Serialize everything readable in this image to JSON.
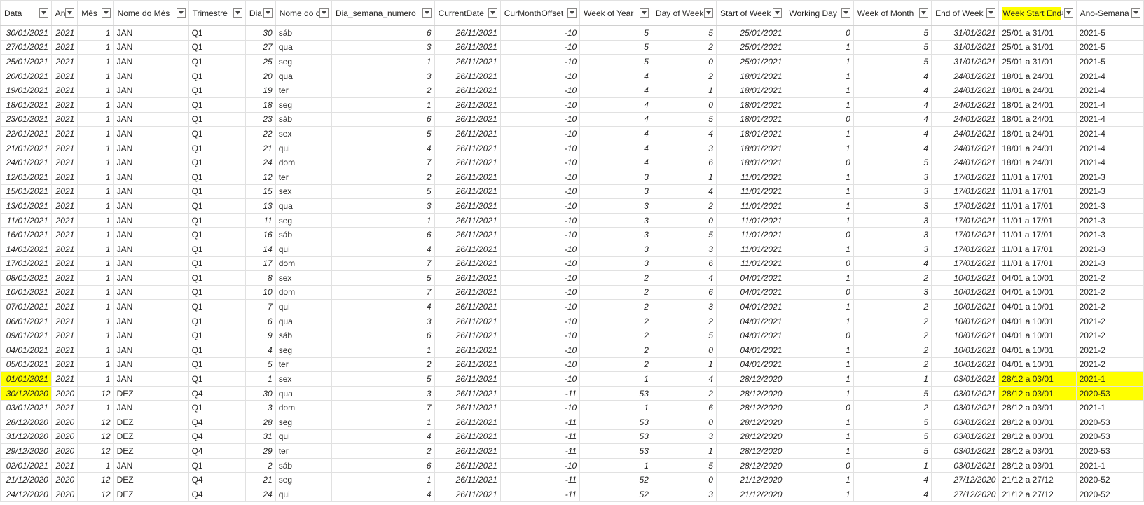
{
  "columns": [
    {
      "label": "Data",
      "type": "d"
    },
    {
      "label": "Ano",
      "type": "n"
    },
    {
      "label": "Mês",
      "type": "n"
    },
    {
      "label": "Nome do Mês",
      "type": "t"
    },
    {
      "label": "Trimestre",
      "type": "t"
    },
    {
      "label": "Dia",
      "type": "n"
    },
    {
      "label": "Nome do dia",
      "type": "t"
    },
    {
      "label": "Dia_semana_numero",
      "type": "n"
    },
    {
      "label": "CurrentDate",
      "type": "d"
    },
    {
      "label": "CurMonthOffset",
      "type": "n"
    },
    {
      "label": "Week of Year",
      "type": "n"
    },
    {
      "label": "Day of Week",
      "type": "n"
    },
    {
      "label": "Start of Week",
      "type": "d"
    },
    {
      "label": "Working Day",
      "type": "n"
    },
    {
      "label": "Week of Month",
      "type": "n"
    },
    {
      "label": "End of Week",
      "type": "d"
    },
    {
      "label": "Week Start End",
      "type": "t",
      "highlight": true,
      "sort": "desc"
    },
    {
      "label": "Ano-Semana",
      "type": "t"
    }
  ],
  "highlight_color": "#ffff00",
  "rows": [
    {
      "cells": [
        "30/01/2021",
        "2021",
        "1",
        "JAN",
        "Q1",
        "30",
        "sáb",
        "6",
        "26/11/2021",
        "-10",
        "5",
        "5",
        "25/01/2021",
        "0",
        "5",
        "31/01/2021",
        "25/01 a 31/01",
        "2021-5"
      ]
    },
    {
      "cells": [
        "27/01/2021",
        "2021",
        "1",
        "JAN",
        "Q1",
        "27",
        "qua",
        "3",
        "26/11/2021",
        "-10",
        "5",
        "2",
        "25/01/2021",
        "1",
        "5",
        "31/01/2021",
        "25/01 a 31/01",
        "2021-5"
      ]
    },
    {
      "cells": [
        "25/01/2021",
        "2021",
        "1",
        "JAN",
        "Q1",
        "25",
        "seg",
        "1",
        "26/11/2021",
        "-10",
        "5",
        "0",
        "25/01/2021",
        "1",
        "5",
        "31/01/2021",
        "25/01 a 31/01",
        "2021-5"
      ]
    },
    {
      "cells": [
        "20/01/2021",
        "2021",
        "1",
        "JAN",
        "Q1",
        "20",
        "qua",
        "3",
        "26/11/2021",
        "-10",
        "4",
        "2",
        "18/01/2021",
        "1",
        "4",
        "24/01/2021",
        "18/01 a 24/01",
        "2021-4"
      ]
    },
    {
      "cells": [
        "19/01/2021",
        "2021",
        "1",
        "JAN",
        "Q1",
        "19",
        "ter",
        "2",
        "26/11/2021",
        "-10",
        "4",
        "1",
        "18/01/2021",
        "1",
        "4",
        "24/01/2021",
        "18/01 a 24/01",
        "2021-4"
      ]
    },
    {
      "cells": [
        "18/01/2021",
        "2021",
        "1",
        "JAN",
        "Q1",
        "18",
        "seg",
        "1",
        "26/11/2021",
        "-10",
        "4",
        "0",
        "18/01/2021",
        "1",
        "4",
        "24/01/2021",
        "18/01 a 24/01",
        "2021-4"
      ]
    },
    {
      "cells": [
        "23/01/2021",
        "2021",
        "1",
        "JAN",
        "Q1",
        "23",
        "sáb",
        "6",
        "26/11/2021",
        "-10",
        "4",
        "5",
        "18/01/2021",
        "0",
        "4",
        "24/01/2021",
        "18/01 a 24/01",
        "2021-4"
      ]
    },
    {
      "cells": [
        "22/01/2021",
        "2021",
        "1",
        "JAN",
        "Q1",
        "22",
        "sex",
        "5",
        "26/11/2021",
        "-10",
        "4",
        "4",
        "18/01/2021",
        "1",
        "4",
        "24/01/2021",
        "18/01 a 24/01",
        "2021-4"
      ]
    },
    {
      "cells": [
        "21/01/2021",
        "2021",
        "1",
        "JAN",
        "Q1",
        "21",
        "qui",
        "4",
        "26/11/2021",
        "-10",
        "4",
        "3",
        "18/01/2021",
        "1",
        "4",
        "24/01/2021",
        "18/01 a 24/01",
        "2021-4"
      ]
    },
    {
      "cells": [
        "24/01/2021",
        "2021",
        "1",
        "JAN",
        "Q1",
        "24",
        "dom",
        "7",
        "26/11/2021",
        "-10",
        "4",
        "6",
        "18/01/2021",
        "0",
        "5",
        "24/01/2021",
        "18/01 a 24/01",
        "2021-4"
      ]
    },
    {
      "cells": [
        "12/01/2021",
        "2021",
        "1",
        "JAN",
        "Q1",
        "12",
        "ter",
        "2",
        "26/11/2021",
        "-10",
        "3",
        "1",
        "11/01/2021",
        "1",
        "3",
        "17/01/2021",
        "11/01 a 17/01",
        "2021-3"
      ]
    },
    {
      "cells": [
        "15/01/2021",
        "2021",
        "1",
        "JAN",
        "Q1",
        "15",
        "sex",
        "5",
        "26/11/2021",
        "-10",
        "3",
        "4",
        "11/01/2021",
        "1",
        "3",
        "17/01/2021",
        "11/01 a 17/01",
        "2021-3"
      ]
    },
    {
      "cells": [
        "13/01/2021",
        "2021",
        "1",
        "JAN",
        "Q1",
        "13",
        "qua",
        "3",
        "26/11/2021",
        "-10",
        "3",
        "2",
        "11/01/2021",
        "1",
        "3",
        "17/01/2021",
        "11/01 a 17/01",
        "2021-3"
      ]
    },
    {
      "cells": [
        "11/01/2021",
        "2021",
        "1",
        "JAN",
        "Q1",
        "11",
        "seg",
        "1",
        "26/11/2021",
        "-10",
        "3",
        "0",
        "11/01/2021",
        "1",
        "3",
        "17/01/2021",
        "11/01 a 17/01",
        "2021-3"
      ]
    },
    {
      "cells": [
        "16/01/2021",
        "2021",
        "1",
        "JAN",
        "Q1",
        "16",
        "sáb",
        "6",
        "26/11/2021",
        "-10",
        "3",
        "5",
        "11/01/2021",
        "0",
        "3",
        "17/01/2021",
        "11/01 a 17/01",
        "2021-3"
      ]
    },
    {
      "cells": [
        "14/01/2021",
        "2021",
        "1",
        "JAN",
        "Q1",
        "14",
        "qui",
        "4",
        "26/11/2021",
        "-10",
        "3",
        "3",
        "11/01/2021",
        "1",
        "3",
        "17/01/2021",
        "11/01 a 17/01",
        "2021-3"
      ]
    },
    {
      "cells": [
        "17/01/2021",
        "2021",
        "1",
        "JAN",
        "Q1",
        "17",
        "dom",
        "7",
        "26/11/2021",
        "-10",
        "3",
        "6",
        "11/01/2021",
        "0",
        "4",
        "17/01/2021",
        "11/01 a 17/01",
        "2021-3"
      ]
    },
    {
      "cells": [
        "08/01/2021",
        "2021",
        "1",
        "JAN",
        "Q1",
        "8",
        "sex",
        "5",
        "26/11/2021",
        "-10",
        "2",
        "4",
        "04/01/2021",
        "1",
        "2",
        "10/01/2021",
        "04/01 a 10/01",
        "2021-2"
      ]
    },
    {
      "cells": [
        "10/01/2021",
        "2021",
        "1",
        "JAN",
        "Q1",
        "10",
        "dom",
        "7",
        "26/11/2021",
        "-10",
        "2",
        "6",
        "04/01/2021",
        "0",
        "3",
        "10/01/2021",
        "04/01 a 10/01",
        "2021-2"
      ]
    },
    {
      "cells": [
        "07/01/2021",
        "2021",
        "1",
        "JAN",
        "Q1",
        "7",
        "qui",
        "4",
        "26/11/2021",
        "-10",
        "2",
        "3",
        "04/01/2021",
        "1",
        "2",
        "10/01/2021",
        "04/01 a 10/01",
        "2021-2"
      ]
    },
    {
      "cells": [
        "06/01/2021",
        "2021",
        "1",
        "JAN",
        "Q1",
        "6",
        "qua",
        "3",
        "26/11/2021",
        "-10",
        "2",
        "2",
        "04/01/2021",
        "1",
        "2",
        "10/01/2021",
        "04/01 a 10/01",
        "2021-2"
      ]
    },
    {
      "cells": [
        "09/01/2021",
        "2021",
        "1",
        "JAN",
        "Q1",
        "9",
        "sáb",
        "6",
        "26/11/2021",
        "-10",
        "2",
        "5",
        "04/01/2021",
        "0",
        "2",
        "10/01/2021",
        "04/01 a 10/01",
        "2021-2"
      ]
    },
    {
      "cells": [
        "04/01/2021",
        "2021",
        "1",
        "JAN",
        "Q1",
        "4",
        "seg",
        "1",
        "26/11/2021",
        "-10",
        "2",
        "0",
        "04/01/2021",
        "1",
        "2",
        "10/01/2021",
        "04/01 a 10/01",
        "2021-2"
      ]
    },
    {
      "cells": [
        "05/01/2021",
        "2021",
        "1",
        "JAN",
        "Q1",
        "5",
        "ter",
        "2",
        "26/11/2021",
        "-10",
        "2",
        "1",
        "04/01/2021",
        "1",
        "2",
        "10/01/2021",
        "04/01 a 10/01",
        "2021-2"
      ]
    },
    {
      "cells": [
        "01/01/2021",
        "2021",
        "1",
        "JAN",
        "Q1",
        "1",
        "sex",
        "5",
        "26/11/2021",
        "-10",
        "1",
        "4",
        "28/12/2020",
        "1",
        "1",
        "03/01/2021",
        "28/12 a 03/01",
        "2021-1"
      ],
      "highlight": [
        0,
        16,
        17
      ]
    },
    {
      "cells": [
        "30/12/2020",
        "2020",
        "12",
        "DEZ",
        "Q4",
        "30",
        "qua",
        "3",
        "26/11/2021",
        "-11",
        "53",
        "2",
        "28/12/2020",
        "1",
        "5",
        "03/01/2021",
        "28/12 a 03/01",
        "2020-53"
      ],
      "highlight": [
        0,
        16,
        17
      ]
    },
    {
      "cells": [
        "03/01/2021",
        "2021",
        "1",
        "JAN",
        "Q1",
        "3",
        "dom",
        "7",
        "26/11/2021",
        "-10",
        "1",
        "6",
        "28/12/2020",
        "0",
        "2",
        "03/01/2021",
        "28/12 a 03/01",
        "2021-1"
      ]
    },
    {
      "cells": [
        "28/12/2020",
        "2020",
        "12",
        "DEZ",
        "Q4",
        "28",
        "seg",
        "1",
        "26/11/2021",
        "-11",
        "53",
        "0",
        "28/12/2020",
        "1",
        "5",
        "03/01/2021",
        "28/12 a 03/01",
        "2020-53"
      ]
    },
    {
      "cells": [
        "31/12/2020",
        "2020",
        "12",
        "DEZ",
        "Q4",
        "31",
        "qui",
        "4",
        "26/11/2021",
        "-11",
        "53",
        "3",
        "28/12/2020",
        "1",
        "5",
        "03/01/2021",
        "28/12 a 03/01",
        "2020-53"
      ]
    },
    {
      "cells": [
        "29/12/2020",
        "2020",
        "12",
        "DEZ",
        "Q4",
        "29",
        "ter",
        "2",
        "26/11/2021",
        "-11",
        "53",
        "1",
        "28/12/2020",
        "1",
        "5",
        "03/01/2021",
        "28/12 a 03/01",
        "2020-53"
      ]
    },
    {
      "cells": [
        "02/01/2021",
        "2021",
        "1",
        "JAN",
        "Q1",
        "2",
        "sáb",
        "6",
        "26/11/2021",
        "-10",
        "1",
        "5",
        "28/12/2020",
        "0",
        "1",
        "03/01/2021",
        "28/12 a 03/01",
        "2021-1"
      ]
    },
    {
      "cells": [
        "21/12/2020",
        "2020",
        "12",
        "DEZ",
        "Q4",
        "21",
        "seg",
        "1",
        "26/11/2021",
        "-11",
        "52",
        "0",
        "21/12/2020",
        "1",
        "4",
        "27/12/2020",
        "21/12 a 27/12",
        "2020-52"
      ]
    },
    {
      "cells": [
        "24/12/2020",
        "2020",
        "12",
        "DEZ",
        "Q4",
        "24",
        "qui",
        "4",
        "26/11/2021",
        "-11",
        "52",
        "3",
        "21/12/2020",
        "1",
        "4",
        "27/12/2020",
        "21/12 a 27/12",
        "2020-52"
      ]
    }
  ]
}
